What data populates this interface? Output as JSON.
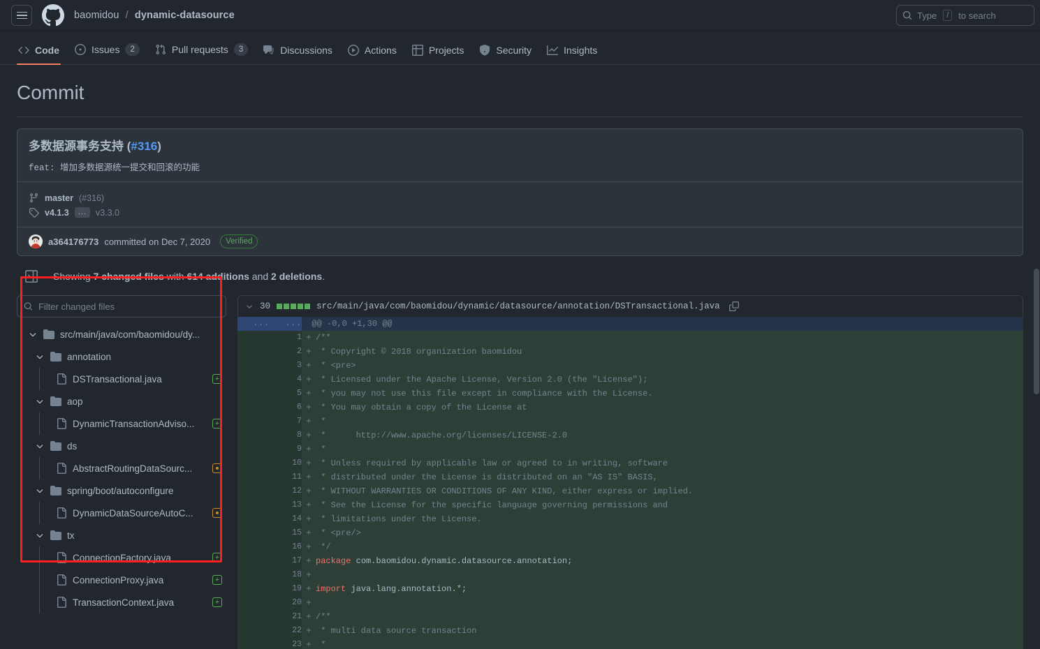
{
  "topbar": {
    "menu_icon": "hamburger-icon",
    "logo_icon": "github-mark-icon",
    "owner": "baomidou",
    "separator": "/",
    "repo": "dynamic-datasource",
    "search": {
      "icon": "search-icon",
      "prefix": "Type",
      "key": "/",
      "suffix": "to search",
      "placeholder": "Type / to search"
    }
  },
  "repo_nav": {
    "items": [
      {
        "label": "Code",
        "icon": "code-icon",
        "count": null,
        "active": true
      },
      {
        "label": "Issues",
        "icon": "issue-opened-icon",
        "count": "2",
        "active": false
      },
      {
        "label": "Pull requests",
        "icon": "git-pull-request-icon",
        "count": "3",
        "active": false
      },
      {
        "label": "Discussions",
        "icon": "comment-discussion-icon",
        "count": null,
        "active": false
      },
      {
        "label": "Actions",
        "icon": "play-icon",
        "count": null,
        "active": false
      },
      {
        "label": "Projects",
        "icon": "table-icon",
        "count": null,
        "active": false
      },
      {
        "label": "Security",
        "icon": "shield-icon",
        "count": null,
        "active": false
      },
      {
        "label": "Insights",
        "icon": "graph-icon",
        "count": null,
        "active": false
      }
    ]
  },
  "page": {
    "title": "Commit"
  },
  "commit": {
    "title_text": "多数据源事务支持",
    "title_issue": "#316",
    "description": "feat: 增加多数据源统一提交和回滚的功能",
    "branch": {
      "icon": "git-branch-icon",
      "name": "master",
      "pr": "(#316)"
    },
    "tags": {
      "icon": "tag-icon",
      "latest": "v4.1.3",
      "ellipsis": "...",
      "older": "v3.3.0"
    },
    "author": "a364176773",
    "committed_text": "committed on Dec 7, 2020",
    "verified_badge": "Verified"
  },
  "showing": {
    "icon": "sidebar-expand-icon",
    "prefix": "Showing",
    "files": "7 changed files",
    "mid": "with",
    "additions": "614 additions",
    "and": "and",
    "deletions": "2 deletions",
    "period": "."
  },
  "file_tree": {
    "filter_placeholder": "Filter changed files",
    "filter_value": "",
    "search_icon": "search-icon",
    "root": {
      "label": "src/main/java/com/baomidou/dy...",
      "icon": "folder-icon",
      "expanded": true
    },
    "nodes": [
      {
        "type": "folder",
        "label": "annotation",
        "depth": 1,
        "expanded": true
      },
      {
        "type": "file",
        "label": "DSTransactional.java",
        "depth": 2,
        "status": "added"
      },
      {
        "type": "folder",
        "label": "aop",
        "depth": 1,
        "expanded": true
      },
      {
        "type": "file",
        "label": "DynamicTransactionAdviso...",
        "depth": 2,
        "status": "added"
      },
      {
        "type": "folder",
        "label": "ds",
        "depth": 1,
        "expanded": true
      },
      {
        "type": "file",
        "label": "AbstractRoutingDataSourc...",
        "depth": 2,
        "status": "modified"
      },
      {
        "type": "folder",
        "label": "spring/boot/autoconfigure",
        "depth": 1,
        "expanded": true
      },
      {
        "type": "file",
        "label": "DynamicDataSourceAutoC...",
        "depth": 2,
        "status": "modified"
      },
      {
        "type": "folder",
        "label": "tx",
        "depth": 1,
        "expanded": true
      },
      {
        "type": "file",
        "label": "ConnectionFactory.java",
        "depth": 2,
        "status": "added"
      },
      {
        "type": "file",
        "label": "ConnectionProxy.java",
        "depth": 2,
        "status": "added"
      },
      {
        "type": "file",
        "label": "TransactionContext.java",
        "depth": 2,
        "status": "added"
      }
    ]
  },
  "diff": {
    "collapse_icon": "chevron-down-icon",
    "change_count": "30",
    "blocks_filled": 5,
    "blocks_total": 5,
    "path": "src/main/java/com/baomidou/dynamic/datasource/annotation/DSTransactional.java",
    "copy_icon": "copy-icon",
    "hunk_header": "@@ -0,0 +1,30 @@",
    "hunk_gutter": "...",
    "lines": [
      {
        "n": "1",
        "marker": "+",
        "text": "/**",
        "style": "comment"
      },
      {
        "n": "2",
        "marker": "+",
        "text": " * Copyright © 2018 organization baomidou",
        "style": "comment"
      },
      {
        "n": "3",
        "marker": "+",
        "text": " * <pre>",
        "style": "comment"
      },
      {
        "n": "4",
        "marker": "+",
        "text": " * Licensed under the Apache License, Version 2.0 (the \"License\");",
        "style": "comment"
      },
      {
        "n": "5",
        "marker": "+",
        "text": " * you may not use this file except in compliance with the License.",
        "style": "comment"
      },
      {
        "n": "6",
        "marker": "+",
        "text": " * You may obtain a copy of the License at",
        "style": "comment"
      },
      {
        "n": "7",
        "marker": "+",
        "text": " *",
        "style": "comment"
      },
      {
        "n": "8",
        "marker": "+",
        "text": " *      http://www.apache.org/licenses/LICENSE-2.0",
        "style": "comment"
      },
      {
        "n": "9",
        "marker": "+",
        "text": " *",
        "style": "comment"
      },
      {
        "n": "10",
        "marker": "+",
        "text": " * Unless required by applicable law or agreed to in writing, software",
        "style": "comment"
      },
      {
        "n": "11",
        "marker": "+",
        "text": " * distributed under the License is distributed on an \"AS IS\" BASIS,",
        "style": "comment"
      },
      {
        "n": "12",
        "marker": "+",
        "text": " * WITHOUT WARRANTIES OR CONDITIONS OF ANY KIND, either express or implied.",
        "style": "comment"
      },
      {
        "n": "13",
        "marker": "+",
        "text": " * See the License for the specific language governing permissions and",
        "style": "comment"
      },
      {
        "n": "14",
        "marker": "+",
        "text": " * limitations under the License.",
        "style": "comment"
      },
      {
        "n": "15",
        "marker": "+",
        "text": " * <pre/>",
        "style": "comment"
      },
      {
        "n": "16",
        "marker": "+",
        "text": " */",
        "style": "comment"
      },
      {
        "n": "17",
        "marker": "+",
        "keyword": "package",
        "text": " com.baomidou.dynamic.datasource.annotation;",
        "style": "code"
      },
      {
        "n": "18",
        "marker": "+",
        "text": "",
        "style": "code"
      },
      {
        "n": "19",
        "marker": "+",
        "keyword": "import",
        "text": " java.lang.annotation.*;",
        "style": "code"
      },
      {
        "n": "20",
        "marker": "+",
        "text": "",
        "style": "code"
      },
      {
        "n": "21",
        "marker": "+",
        "text": "/**",
        "style": "comment"
      },
      {
        "n": "22",
        "marker": "+",
        "text": " * multi data source transaction",
        "style": "comment"
      },
      {
        "n": "23",
        "marker": "+",
        "text": " *",
        "style": "comment"
      }
    ]
  },
  "colors": {
    "page_bg": "#22272e",
    "card_bg": "#2d333b",
    "accent_link": "#539bf5",
    "added_green": "#57ab5a",
    "modified_orange": "#c69026",
    "diff_add_bg": "#2d3f37",
    "hunk_blue": "#2f4573",
    "annotation_red": "#ff1f1f",
    "active_tab": "#f78166"
  }
}
